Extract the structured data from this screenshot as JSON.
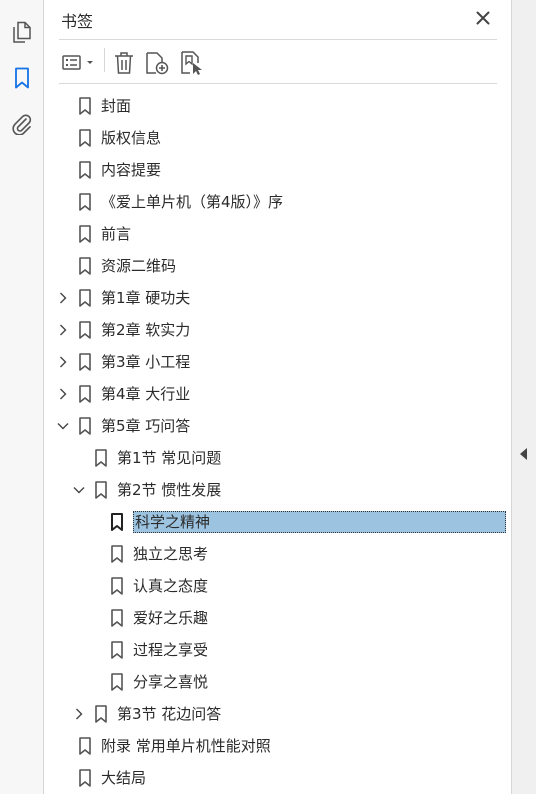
{
  "panel": {
    "title": "书签"
  },
  "toolbar": {
    "options_icon": "list-options-icon",
    "delete_icon": "trash-icon",
    "new_bookmark_icon": "new-bookmark-icon",
    "find_bookmark_icon": "find-current-bookmark-icon"
  },
  "rail": {
    "items": [
      "page-thumbnails-icon",
      "bookmark-icon",
      "attachment-icon"
    ],
    "active": "bookmark-icon"
  },
  "colors": {
    "accent": "#1473e6",
    "selection": "#9cc4e0"
  },
  "bookmarks": [
    {
      "label": "封面",
      "level": 0,
      "expandable": false
    },
    {
      "label": "版权信息",
      "level": 0,
      "expandable": false
    },
    {
      "label": "内容提要",
      "level": 0,
      "expandable": false
    },
    {
      "label": "《爱上单片机（第4版）》序",
      "level": 0,
      "expandable": false
    },
    {
      "label": "前言",
      "level": 0,
      "expandable": false
    },
    {
      "label": "资源二维码",
      "level": 0,
      "expandable": false
    },
    {
      "label": "第1章 硬功夫",
      "level": 0,
      "expandable": true,
      "expanded": false
    },
    {
      "label": "第2章 软实力",
      "level": 0,
      "expandable": true,
      "expanded": false
    },
    {
      "label": "第3章 小工程",
      "level": 0,
      "expandable": true,
      "expanded": false
    },
    {
      "label": "第4章 大行业",
      "level": 0,
      "expandable": true,
      "expanded": false
    },
    {
      "label": "第5章 巧问答",
      "level": 0,
      "expandable": true,
      "expanded": true
    },
    {
      "label": "第1节 常见问题",
      "level": 1,
      "expandable": false
    },
    {
      "label": "第2节 惯性发展",
      "level": 1,
      "expandable": true,
      "expanded": true
    },
    {
      "label": "科学之精神",
      "level": 2,
      "expandable": false,
      "selected": true
    },
    {
      "label": "独立之思考",
      "level": 2,
      "expandable": false
    },
    {
      "label": "认真之态度",
      "level": 2,
      "expandable": false
    },
    {
      "label": "爱好之乐趣",
      "level": 2,
      "expandable": false
    },
    {
      "label": "过程之享受",
      "level": 2,
      "expandable": false
    },
    {
      "label": "分享之喜悦",
      "level": 2,
      "expandable": false
    },
    {
      "label": "第3节 花边问答",
      "level": 1,
      "expandable": true,
      "expanded": false
    },
    {
      "label": "附录 常用单片机性能对照",
      "level": 0,
      "expandable": false
    },
    {
      "label": "大结局",
      "level": 0,
      "expandable": false
    }
  ]
}
